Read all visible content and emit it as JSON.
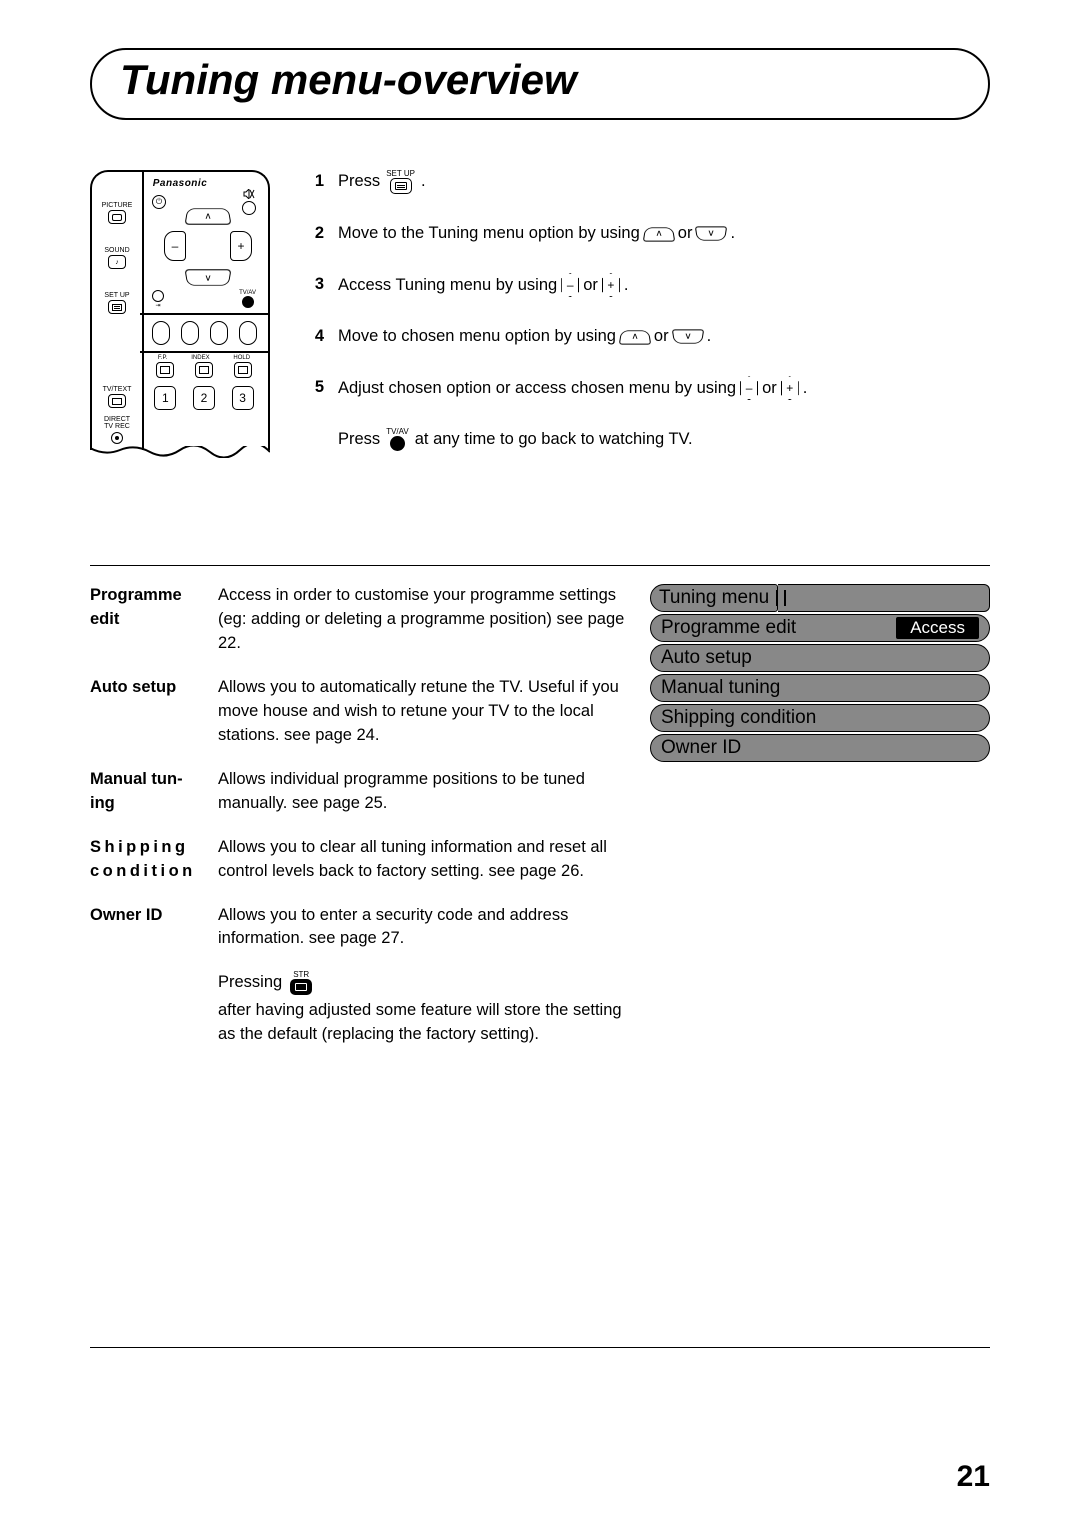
{
  "title": "Tuning menu-overview",
  "remote": {
    "brand": "Panasonic",
    "side_labels": {
      "picture": "PICTURE",
      "sound": "SOUND",
      "setup": "SET UP"
    },
    "row_labels": {
      "tvav": "TV/AV",
      "tvtext": "TV/TEXT",
      "fp": "F.P.",
      "index": "INDEX",
      "hold": "HOLD",
      "direct": "DIRECT\nTV REC"
    },
    "numbers": [
      "1",
      "2",
      "3"
    ],
    "dpad": {
      "minus": "–",
      "plus": "+"
    }
  },
  "icons": {
    "setup_label": "SET UP",
    "tvav_label": "TV/AV",
    "str_label": "STR",
    "minus": "–",
    "plus": "+",
    "up": "∧",
    "down": "∨"
  },
  "steps": [
    {
      "n": "1",
      "pre": "Press ",
      "post": " ."
    },
    {
      "n": "2",
      "pre": "Move to the Tuning menu option by using ",
      "mid": " or ",
      "post": " ."
    },
    {
      "n": "3",
      "pre": "Access Tuning menu by using ",
      "mid": " or ",
      "post": " ."
    },
    {
      "n": "4",
      "pre": "Move to chosen menu option by using ",
      "mid": " or ",
      "post": " ."
    },
    {
      "n": "5",
      "pre": "Adjust chosen option or access chosen menu by using ",
      "mid": " or ",
      "post": " ."
    }
  ],
  "press_back": {
    "pre": "Press ",
    "post": " at any time to go back to watching TV."
  },
  "defs": [
    {
      "term": "Programme edit",
      "desc": "Access in order to customise your programme settings (eg: adding or deleting a programme position) see page 22."
    },
    {
      "term": "Auto setup",
      "desc": "Allows you to automatically retune the TV. Useful if you move house and wish to retune your TV to the local stations. see page 24."
    },
    {
      "term": "Manual tuning",
      "term_display": "Manual tun-\ning",
      "desc": "Allows individual programme positions to be tuned manually. see page 25."
    },
    {
      "term": "Shipping condition",
      "spaced": true,
      "desc": "Allows you to clear all tuning information and reset all control levels back to factory setting. see page 26."
    },
    {
      "term": "Owner ID",
      "desc": "Allows you to enter a security code and address information. see page 27."
    }
  ],
  "foot_note": {
    "pre": "Pressing ",
    "post": " after having adjusted some feature will store the setting as the  default (replacing the factory setting)."
  },
  "osd": {
    "title": "Tuning menu",
    "rows": [
      {
        "label": "Programme edit",
        "badge": "Access"
      },
      {
        "label": "Auto setup"
      },
      {
        "label": "Manual tuning"
      },
      {
        "label": "Shipping condition"
      },
      {
        "label": "Owner ID"
      }
    ]
  },
  "page_number": "21"
}
